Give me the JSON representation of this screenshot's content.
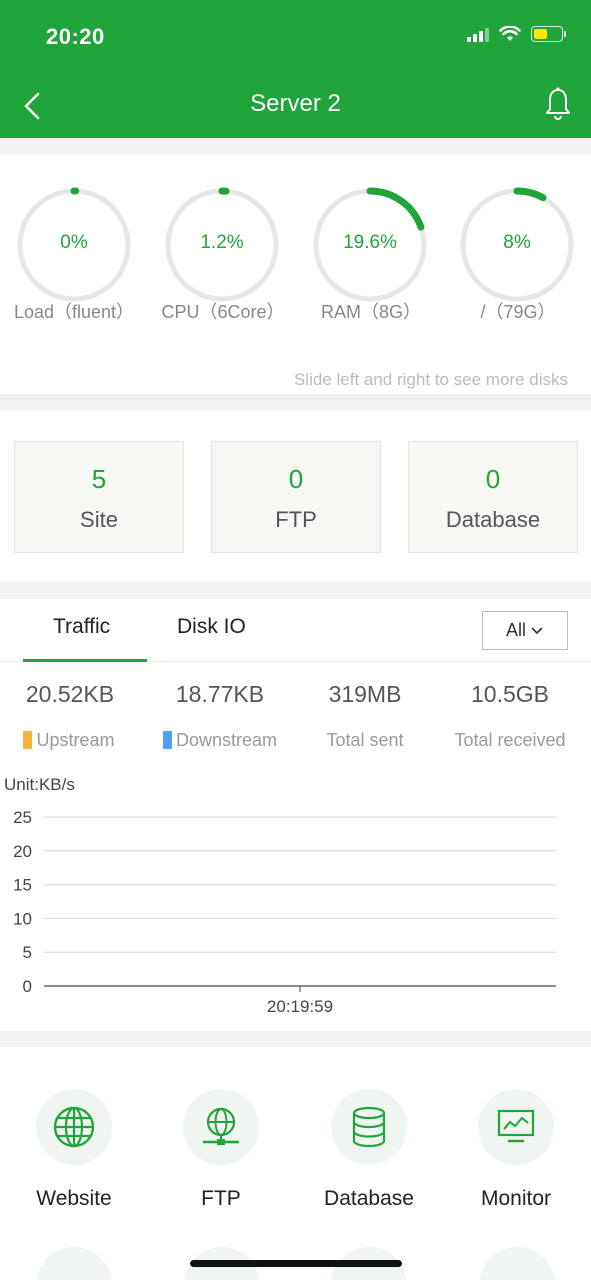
{
  "status_bar": {
    "time": "20:20"
  },
  "nav": {
    "title": "Server 2"
  },
  "gauges": [
    {
      "value_text": "0%",
      "percent": 0,
      "label": "Load（fluent）"
    },
    {
      "value_text": "1.2%",
      "percent": 1.2,
      "label": "CPU（6Core）"
    },
    {
      "value_text": "19.6%",
      "percent": 19.6,
      "label": "RAM（8G）"
    },
    {
      "value_text": "8%",
      "percent": 8,
      "label": "/（79G）"
    }
  ],
  "disk_hint": "Slide left and right to see more disks",
  "stats": [
    {
      "value": "5",
      "label": "Site"
    },
    {
      "value": "0",
      "label": "FTP"
    },
    {
      "value": "0",
      "label": "Database"
    }
  ],
  "traffic": {
    "tabs": [
      "Traffic",
      "Disk IO"
    ],
    "active_tab": "Traffic",
    "filter": "All",
    "metrics": [
      {
        "value": "20.52KB",
        "label": "Upstream",
        "color": "#f5b041"
      },
      {
        "value": "18.77KB",
        "label": "Downstream",
        "color": "#4da3f5"
      },
      {
        "value": "319MB",
        "label": "Total sent"
      },
      {
        "value": "10.5GB",
        "label": "Total received"
      }
    ],
    "unit": "Unit:KB/s"
  },
  "chart_data": {
    "type": "line",
    "title": "",
    "xlabel": "",
    "ylabel": "Unit:KB/s",
    "ylim": [
      0,
      25
    ],
    "yticks": [
      25,
      20,
      15,
      10,
      5,
      0
    ],
    "x": [
      "20:19:59"
    ],
    "series": [],
    "grid": true
  },
  "menu": [
    {
      "label": "Website",
      "icon": "globe-icon"
    },
    {
      "label": "FTP",
      "icon": "ftp-globe-icon"
    },
    {
      "label": "Database",
      "icon": "database-icon"
    },
    {
      "label": "Monitor",
      "icon": "monitor-icon"
    }
  ],
  "colors": {
    "accent": "#20a53a",
    "background_gap": "#f2f2f2"
  }
}
